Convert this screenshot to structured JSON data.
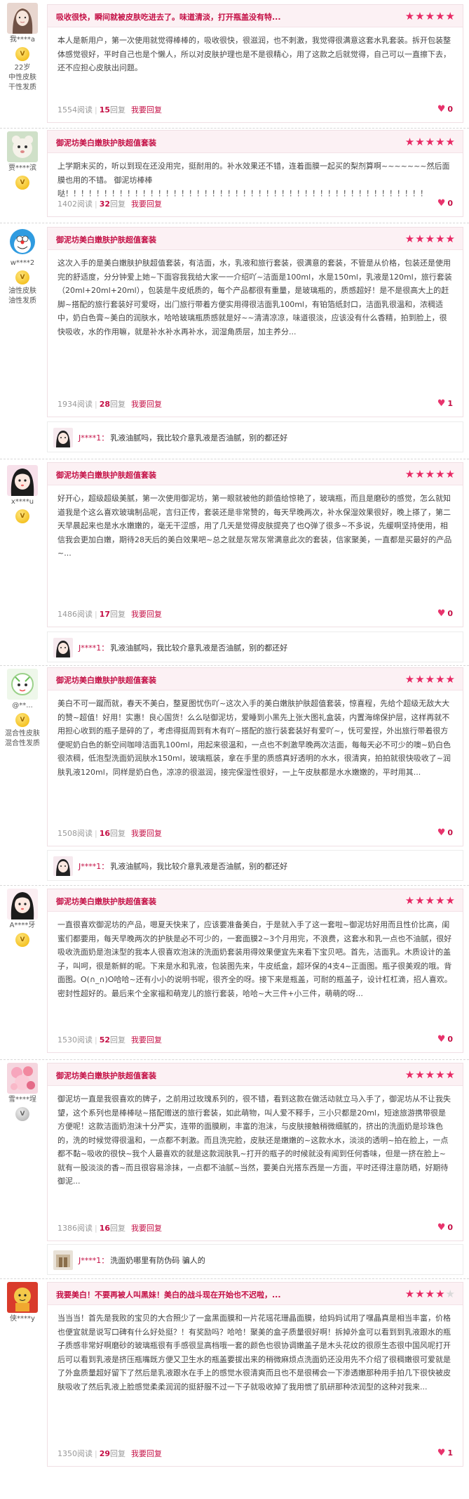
{
  "reviews": [
    {
      "user": {
        "name": "我****a",
        "lines": [
          "22岁",
          "中性皮肤",
          "干性发质"
        ]
      },
      "title": "吸收很快，瞬间就被皮肤吃进去了。味道清淡，打开瓶盖没有特...",
      "rating": 5,
      "body": "本人是新用户，第一次使用就觉得棒棒的，吸收很快，很滋润，也不刺激，我觉得很满意这套水乳套装。拆开包装整体感觉很好，平时自己也是个懒人，所以对皮肤护理也是不是很精心，用了这款之后就觉得，自己可以一直擦下去，还不应担心皮肤出问题。",
      "views": "1554阅读",
      "replies": "15",
      "replies_label": "回复",
      "reply_action": "我要回复",
      "likes": "0"
    },
    {
      "user": {
        "name": "贾****滨",
        "lines": []
      },
      "title": "御泥坊美白嫩肤护肤超值套装",
      "rating": 5,
      "body": "上学期末买的，听以到现在还没用完，挺耐用的。补水效果还不错，连着面膜一起买的梨剂算啊~~~~~~~然后面膜也用的不错。 御泥坊棒棒哒！！！！！！！！！！！！！！！！！！！！！！！！！！！！！！！！！！！！！！！！！！！！！！！",
      "views": "1402阅读",
      "replies": "32",
      "replies_label": "回复",
      "reply_action": "我要回复",
      "likes": "0"
    },
    {
      "user": {
        "name": "w****2",
        "lines": [
          "油性皮肤",
          "油性发质"
        ]
      },
      "title": "御泥坊美白嫩肤护肤超值套装",
      "rating": 5,
      "body": "这次入手的是美白嫩肤护肤超值套装，有洁面，水，乳液和旅行套装，很满意的套装，不管是从价格，包装还是使用完的舒适度，分分钟爱上她~下面容我我给大家一一介绍吖~洁面是100ml，水是150ml，乳液是120ml，旅行套装（20ml+20ml+20ml），包装是牛皮纸质的，每个产品都很有重量，是玻璃瓶的，质感超好！是不是很高大上的赶脚~搭配的旅行套装好可爱呀，出门旅行带着方便实用得很洁面乳100ml，有铂箔纸封口，洁面乳很温和，浓稠适中，奶白色膏~美白的润肤水，哈哈玻璃瓶质感就是好~~清清凉凉，味道很淡，应该没有什么香精，拍到脸上，很快吸收，水的作用嘛，就是补水补水再补水，润湿角质层，加主养分...",
      "views": "1934阅读",
      "replies": "28",
      "replies_label": "回复",
      "reply_action": "我要回复",
      "likes": "1",
      "reply": {
        "name": "J****1：",
        "text": "乳液油腻吗，我比较介意乳液是否油腻，别的都还好"
      }
    },
    {
      "user": {
        "name": "x****u",
        "lines": []
      },
      "title": "御泥坊美白嫩肤护肤超值套装",
      "rating": 5,
      "body": "好开心，超级超级美腻，第一次使用御泥坊，第一眼就被他的颜值给惊艳了，玻璃瓶，而且是磨砂的感觉，怎么就知道我是个这么喜欢玻璃制品呢，言归正传，套装还是非常赞的，每天早晚两次，补水保湿效果很好，晚上搽了，第二天早晨起来也是水水嫩嫩的，毫无干涩感，用了几天是觉得皮肤提亮了也Q弹了很多~不多说，先缓啊坚持使用，相信我会更加白嫩，期待28天后的美白效果吧~总之就是灰常灰常满意此次的套装，信家聚美，一直都是买最好的产品~...",
      "views": "1486阅读",
      "replies": "17",
      "replies_label": "回复",
      "reply_action": "我要回复",
      "likes": "0",
      "reply": {
        "name": "J****1：",
        "text": "乳液油腻吗，我比较介意乳液是否油腻，别的都还好"
      }
    },
    {
      "user": {
        "name": "@**...",
        "lines": [
          "混合性皮肤",
          "混合性发质"
        ]
      },
      "title": "御泥坊美白嫩肤护肤超值套装",
      "rating": 5,
      "body": "美白不可一蹴而就，春天不美白，整夏图忧伤吖~这次入手的美白嫩肤护肤超值套装，惊喜程，先给个超级无敌大大的赞~超值！好用！实惠！良心国货！么么哒御泥坊，爱睡到小黑先上张大图礼盒装，内置海绵保护层，这样再就不用担心收到的瓶子是碎的了，考虑得挺周到有木有吖~搭配的旅行装套装好有爱吖~，怃可爱捏，外出旅行带着很方便呢奶白色的新空间咖啡洁面乳100ml，用起来很温和，一点也不刺激早晚两次洁面，每每天必不可少的噢~奶白色很浓稠，低泡型洗面奶润肤水150ml，玻璃瓶装，拿在手里的质感真好透明的水水，很清爽，拍拍就很快吸收了~润肤乳液120ml，同样是奶白色，凉凉的很滋润，接完保湿性很好，一上午皮肤都是水水嫩嫩的，平时用其...",
      "views": "1508阅读",
      "replies": "16",
      "replies_label": "回复",
      "reply_action": "我要回复",
      "likes": "0",
      "reply": {
        "name": "J****1：",
        "text": "乳液油腻吗，我比较介意乳液是否油腻，别的都还好"
      }
    },
    {
      "user": {
        "name": "A****牙",
        "lines": []
      },
      "title": "御泥坊美白嫩肤护肤超值套装",
      "rating": 5,
      "body": "一直很喜欢御泥坊的产品，嗯夏天快来了，应该要准备美白，于是就入手了这一套啦~御泥坊好用而且性价比高，闺蜜们都要用，每天早晚两次的护肤是必不可少的，一套面膜2~3个月用完，不浪费，这套水和乳一点也不油腻，很好吸收洗面奶是泡沫型的我本人很喜欢泡沫的洗面奶套装用得效果便宜先来看下宝贝吧。首先，洁面乳。木质设计的盖子，叫呵，很是新鲜的呢。下来是水和乳液，包装图先来，牛皮纸盒，超环保的4支4~正面图。瓶子很美观的哦。背面图。О(∩_∩)О哈哈~还有小小的说明书呢，很齐全的呀。接下来是瓶盖，可耐的瓶盖子，设计杠杠滴，招人喜欢。密封性超好的。最后来个全家福和萌宠儿的旅行套装，哈哈~大三件+小三件，萌萌的呀...",
      "views": "1530阅读",
      "replies": "52",
      "replies_label": "回复",
      "reply_action": "我要回复",
      "likes": "0"
    },
    {
      "user": {
        "name": "雪****埕",
        "lines": []
      },
      "title": "御泥坊美白嫩肤护肤超值套装",
      "rating": 5,
      "body": "御泥坊一直是我很喜欢的牌子，之前用过玫瑰系列的，很不错，看到这款在做活动就立马入手了，御泥坊从不让我失望，这个系列也是棒棒哒~搭配赠送的旅行套装，如此萌物，叫人爱不释手，三小只都是20ml，短途旅游携带很是方便呢！这款洁面奶泡沫十分严实，连带的面膜刷，丰富的泡沫，与皮肤接触稍微细腻的，挤出的洗面奶是珍珠色的，洗的时候觉得很温和，一点都不刺激。而且洗完脸，皮肤还是嫩嫩的~这款水水，淡淡的透明~拍在脸上，一点都不黏~吸收的很快~我个人最喜欢的就是这款润肤乳~打开的瓶子的时候就没有闻到任何香味，但是一挤在脸上~就有一股淡淡的香~而且很容易涂抹，一点都不油腻~当然，要美白光搭东西是一方面，平时还得注意防晒，好期待御泥...",
      "views": "1386阅读",
      "replies": "16",
      "replies_label": "回复",
      "reply_action": "我要回复",
      "likes": "0",
      "reply": {
        "name": "J****1：",
        "text": "洗面奶哪里有防伪码 骗人的"
      }
    },
    {
      "user": {
        "name": "侠****y",
        "lines": []
      },
      "title": "我要美白！不要再被人叫黑妹！美白的战斗现在开始也不迟啦，...",
      "rating": 4,
      "body": "当当当！首先是我败的宝贝的大合照少了一盒黑面膜和一片花瑶花珊晶面膜，给妈妈试用了嘿晶真是相当丰富，价格也便宜就是说写口碑有什么好处挺？！有奖励吗？哈哈！聚美的盒子质量很好啊！拆掉外盒可以看到到乳液跟水的瓶子质感非常好啊磨砂的玻璃瓶很有手感很显高档哦一套的颜色也很协调嫩盖子是木头花纹的很原生态很中国风呢打开后可以看到乳液是挤压瓶嘴既方便又卫生水的瓶盖要拔出来的稍微麻烦点洗面奶还没用先不介绍了很稠嫩很可爱就是了外盒质量超好留下了然后是乳液跟水在手上的感觉水很清爽而且也不是很稀会一下渗透嫩那种用手拍几下很快被皮肤吸收了然后乳液上脸感觉柔柔润润的挺舒服不过一下子就吸收掉了我用惯了肌研那种浓润型的这种对我来...",
      "views": "1350阅读",
      "replies": "29",
      "replies_label": "回复",
      "reply_action": "我要回复",
      "likes": "1"
    }
  ],
  "colors": {
    "accent": "#c40f45",
    "star": "#e82864",
    "header_bg": "#fcf1f4"
  }
}
